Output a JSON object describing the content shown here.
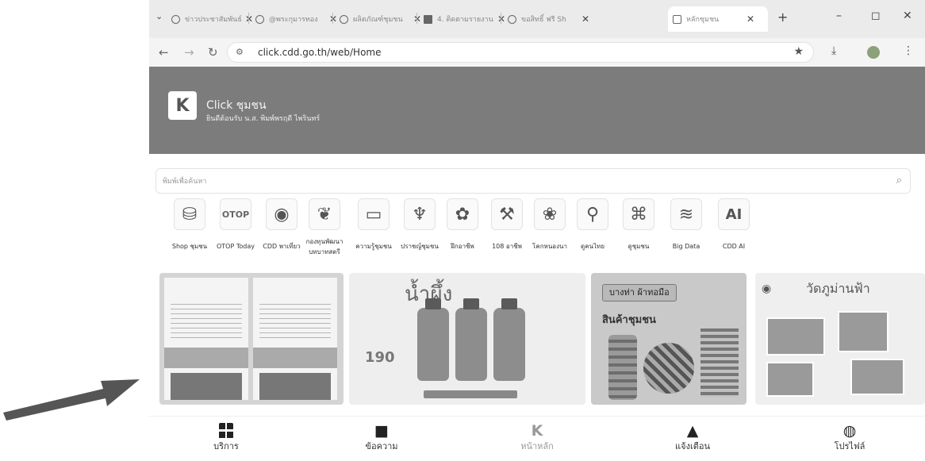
{
  "browser": {
    "tabs_menu_icon": "chevron-down-icon",
    "tabs": [
      {
        "title": "ข่าวประชาสัมพันธ์",
        "icon": "globe-icon"
      },
      {
        "title": "@พระกุมารทอง",
        "icon": "globe-icon"
      },
      {
        "title": "ผลิตภัณฑ์ชุมชน",
        "icon": "globe-icon"
      },
      {
        "title": "4. ติดตามรายงาน",
        "icon": "sheet-icon"
      },
      {
        "title": "ขอสิทธิ์ ฟรี Sh",
        "icon": "globe-icon"
      },
      {
        "title": "หลักชุมชน",
        "icon": "site-icon",
        "active": true
      }
    ],
    "new_tab": "+",
    "window_controls": {
      "minimize": "–",
      "maximize": "◻",
      "close": "✕"
    },
    "url": "click.cdd.go.th/web/Home",
    "close_glyph": "✕"
  },
  "header": {
    "logo_glyph": "K",
    "app_name": "Click ชุมชน",
    "welcome": "ยินดีต้อนรับ น.ส. พิมพ์พรฤดี ไพรินทร์"
  },
  "search": {
    "placeholder": "พิมพ์เพื่อค้นหา"
  },
  "services": [
    {
      "label": "Shop ชุมชน",
      "icon": "shop-bag-icon"
    },
    {
      "label": "OTOP Today",
      "icon": "otop-logo-icon",
      "text": "OTOP"
    },
    {
      "label": "CDD พาเที่ยว",
      "icon": "map-pin-icon"
    },
    {
      "label": "กองทุนพัฒนาบทบาทสตรี",
      "icon": "women-fund-icon"
    },
    {
      "label": "ความรู้ชุมชน",
      "icon": "book-icon"
    },
    {
      "label": "ปราชญ์ชุมชน",
      "icon": "sage-icon"
    },
    {
      "label": "ฝึกอาชีพ",
      "icon": "piggy-bank-icon"
    },
    {
      "label": "108 อาชีพ",
      "icon": "career-icon"
    },
    {
      "label": "โคกหนองนา",
      "icon": "sprout-icon"
    },
    {
      "label": "ดูคนไทย",
      "icon": "find-person-icon"
    },
    {
      "label": "ดูชุมชน",
      "icon": "community-map-icon"
    },
    {
      "label": "Big Data",
      "icon": "big-data-icon"
    },
    {
      "label": "CDD AI",
      "icon": "ai-icon",
      "text": "AI"
    }
  ],
  "banners": [
    {
      "name": "newsletter-banner"
    },
    {
      "name": "drink-banner",
      "title": "น้ำผึ้ง",
      "price": "190"
    },
    {
      "name": "textile-banner",
      "title": "บางท่า ผ้าทอมือ",
      "subtitle": "สินค้าชุมชน"
    },
    {
      "name": "temple-banner",
      "title": "วัดภูม่านฟ้า"
    }
  ],
  "bottom_nav": [
    {
      "label": "บริการ",
      "icon": "grid-icon"
    },
    {
      "label": "ข้อความ",
      "icon": "message-icon"
    },
    {
      "label": "หน้าหลัก",
      "icon": "home-logo-icon"
    },
    {
      "label": "แจ้งเตือน",
      "icon": "bell-icon"
    },
    {
      "label": "โปรไฟล์",
      "icon": "profile-icon"
    }
  ],
  "colors": {
    "header_bg": "#7c7c7c",
    "tabstrip_bg": "#ebebeb"
  }
}
